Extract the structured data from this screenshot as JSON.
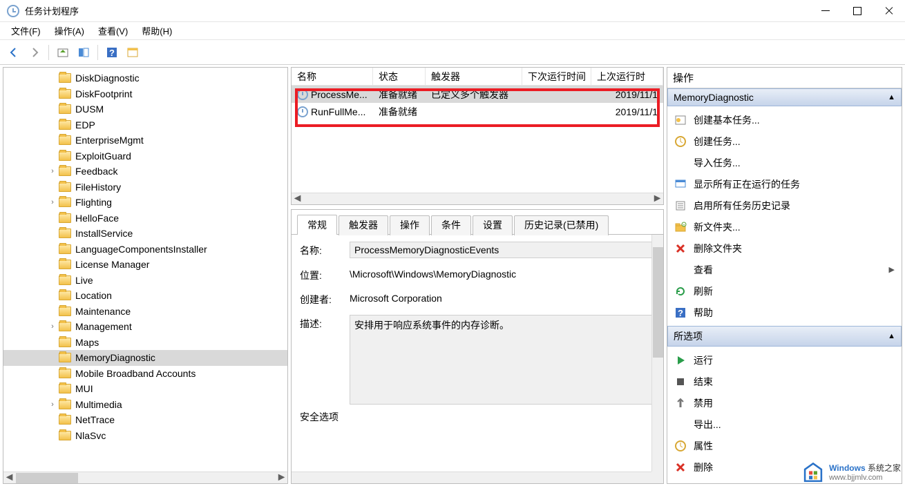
{
  "window": {
    "title": "任务计划程序"
  },
  "menu": {
    "file": "文件(F)",
    "action": "操作(A)",
    "view": "查看(V)",
    "help": "帮助(H)"
  },
  "tree": {
    "items": [
      {
        "label": "DiskDiagnostic",
        "expander": ""
      },
      {
        "label": "DiskFootprint",
        "expander": ""
      },
      {
        "label": "DUSM",
        "expander": ""
      },
      {
        "label": "EDP",
        "expander": ""
      },
      {
        "label": "EnterpriseMgmt",
        "expander": ""
      },
      {
        "label": "ExploitGuard",
        "expander": ""
      },
      {
        "label": "Feedback",
        "expander": "›"
      },
      {
        "label": "FileHistory",
        "expander": ""
      },
      {
        "label": "Flighting",
        "expander": "›"
      },
      {
        "label": "HelloFace",
        "expander": ""
      },
      {
        "label": "InstallService",
        "expander": ""
      },
      {
        "label": "LanguageComponentsInstaller",
        "expander": ""
      },
      {
        "label": "License Manager",
        "expander": ""
      },
      {
        "label": "Live",
        "expander": ""
      },
      {
        "label": "Location",
        "expander": ""
      },
      {
        "label": "Maintenance",
        "expander": ""
      },
      {
        "label": "Management",
        "expander": "›"
      },
      {
        "label": "Maps",
        "expander": ""
      },
      {
        "label": "MemoryDiagnostic",
        "expander": "",
        "selected": true
      },
      {
        "label": "Mobile Broadband Accounts",
        "expander": ""
      },
      {
        "label": "MUI",
        "expander": ""
      },
      {
        "label": "Multimedia",
        "expander": "›"
      },
      {
        "label": "NetTrace",
        "expander": ""
      },
      {
        "label": "NlaSvc",
        "expander": ""
      }
    ]
  },
  "tasks": {
    "headers": {
      "name": "名称",
      "status": "状态",
      "trigger": "触发器",
      "next": "下次运行时间",
      "last": "上次运行时"
    },
    "rows": [
      {
        "name": "ProcessMe...",
        "status": "准备就绪",
        "trigger": "已定义多个触发器",
        "next": "",
        "last": "2019/11/1",
        "selected": true
      },
      {
        "name": "RunFullMe...",
        "status": "准备就绪",
        "trigger": "",
        "next": "",
        "last": "2019/11/1"
      }
    ]
  },
  "detail": {
    "tabs": {
      "general": "常规",
      "triggers": "触发器",
      "actions": "操作",
      "conditions": "条件",
      "settings": "设置",
      "history": "历史记录(已禁用)"
    },
    "labels": {
      "name": "名称:",
      "location": "位置:",
      "author": "创建者:",
      "description": "描述:",
      "security": "安全选项"
    },
    "values": {
      "name": "ProcessMemoryDiagnosticEvents",
      "location": "\\Microsoft\\Windows\\MemoryDiagnostic",
      "author": "Microsoft Corporation",
      "description": "安排用于响应系统事件的内存诊断。"
    }
  },
  "actions": {
    "header": "操作",
    "section1_title": "MemoryDiagnostic",
    "group1": [
      {
        "label": "创建基本任务...",
        "icon": "task-basic"
      },
      {
        "label": "创建任务...",
        "icon": "task-create"
      },
      {
        "label": "导入任务...",
        "icon": "blank"
      },
      {
        "label": "显示所有正在运行的任务",
        "icon": "display-running"
      },
      {
        "label": "启用所有任务历史记录",
        "icon": "history"
      },
      {
        "label": "新文件夹...",
        "icon": "new-folder"
      },
      {
        "label": "删除文件夹",
        "icon": "delete"
      },
      {
        "label": "查看",
        "icon": "blank",
        "submenu": true
      },
      {
        "label": "刷新",
        "icon": "refresh"
      },
      {
        "label": "帮助",
        "icon": "help"
      }
    ],
    "section2_title": "所选项",
    "group2": [
      {
        "label": "运行",
        "icon": "run"
      },
      {
        "label": "结束",
        "icon": "stop"
      },
      {
        "label": "禁用",
        "icon": "disable"
      },
      {
        "label": "导出...",
        "icon": "blank"
      },
      {
        "label": "属性",
        "icon": "properties"
      },
      {
        "label": "删除",
        "icon": "delete"
      }
    ]
  },
  "watermark": {
    "line1": "Windows 系统之家",
    "line2": "www.bjjmlv.com"
  }
}
